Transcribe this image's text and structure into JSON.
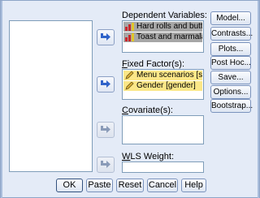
{
  "dependent": {
    "label": "Dependent Variables:",
    "items": [
      "Hard rolls and butte...",
      "Toast and marmala..."
    ]
  },
  "fixed": {
    "label": "Fixed Factor(s):",
    "items": [
      "Menu scenarios [src...",
      "Gender [gender]"
    ]
  },
  "covariate": {
    "label": "Covariate(s):"
  },
  "wls": {
    "label": "WLS Weight:",
    "value": ""
  },
  "side_buttons": [
    "Model...",
    "Contrasts...",
    "Plots...",
    "Post Hoc...",
    "Save...",
    "Options...",
    "Bootstrap..."
  ],
  "bottom_buttons": [
    "OK",
    "Paste",
    "Reset",
    "Cancel",
    "Help"
  ],
  "colors": {
    "dialog_bg": "#e4ebf7",
    "selected_dark": "#a6a6a6",
    "selected_yellow": "#fbe788",
    "arrow_blue": "#2f62c9"
  },
  "icons": {
    "scale_variable": "ruler-bar-icon",
    "nominal_variable": "pencil-icon",
    "move_arrow": "arrow-right-icon"
  }
}
